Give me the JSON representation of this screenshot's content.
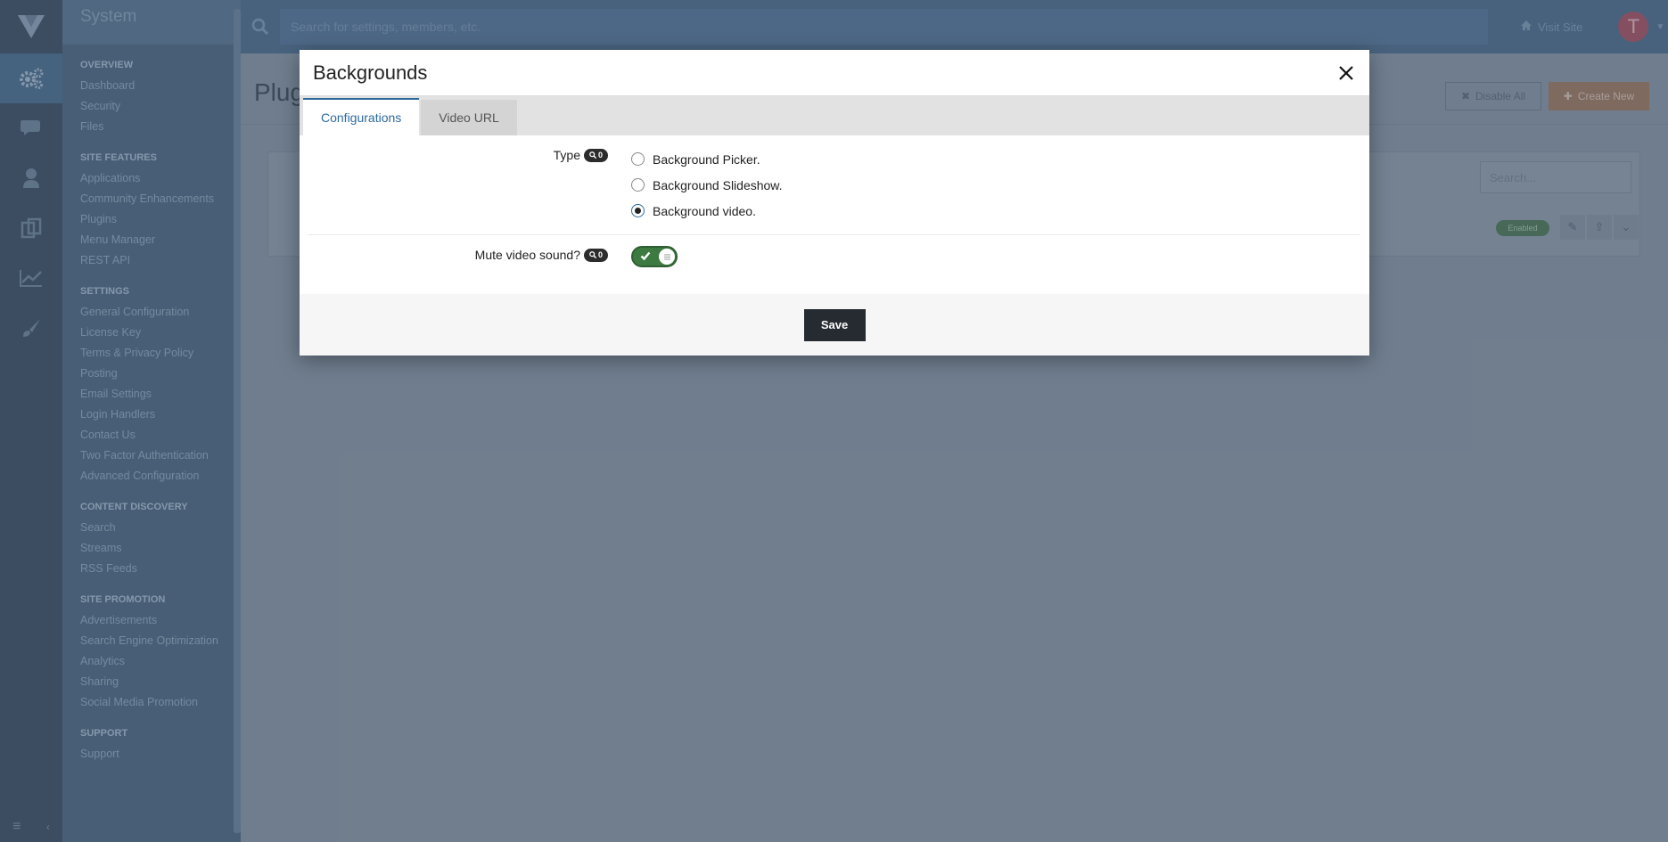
{
  "sidebar": {
    "title": "System",
    "groups": [
      {
        "title": "OVERVIEW",
        "items": [
          "Dashboard",
          "Security",
          "Files"
        ]
      },
      {
        "title": "SITE FEATURES",
        "items": [
          "Applications",
          "Community Enhancements",
          "Plugins",
          "Menu Manager",
          "REST API"
        ]
      },
      {
        "title": "SETTINGS",
        "items": [
          "General Configuration",
          "License Key",
          "Terms & Privacy Policy",
          "Posting",
          "Email Settings",
          "Login Handlers",
          "Contact Us",
          "Two Factor Authentication",
          "Advanced Configuration"
        ]
      },
      {
        "title": "CONTENT DISCOVERY",
        "items": [
          "Search",
          "Streams",
          "RSS Feeds"
        ]
      },
      {
        "title": "SITE PROMOTION",
        "items": [
          "Advertisements",
          "Search Engine Optimization",
          "Analytics",
          "Sharing",
          "Social Media Promotion"
        ]
      },
      {
        "title": "SUPPORT",
        "items": [
          "Support"
        ]
      }
    ]
  },
  "topbar": {
    "search_placeholder": "Search for settings, members, etc.",
    "visit_site": "Visit Site",
    "avatar_letter": "T"
  },
  "page": {
    "title": "Plug",
    "disable_all": "Disable All",
    "create_new": "Create New",
    "table_search_placeholder": "Search...",
    "row_status": "Enabled"
  },
  "modal": {
    "title": "Backgrounds",
    "tabs": [
      {
        "label": "Configurations",
        "active": true
      },
      {
        "label": "Video URL",
        "active": false
      }
    ],
    "type_label": "Type",
    "type_badge_count": "0",
    "type_options": [
      {
        "label": "Background Picker.",
        "checked": false
      },
      {
        "label": "Background Slideshow.",
        "checked": false
      },
      {
        "label": "Background video.",
        "checked": true
      }
    ],
    "mute_label": "Mute video sound?",
    "mute_badge_count": "0",
    "mute_enabled": true,
    "save_label": "Save"
  },
  "colors": {
    "accent": "#2e6a9e",
    "toggle_on": "#3d7a41",
    "save_button": "#252b30"
  }
}
